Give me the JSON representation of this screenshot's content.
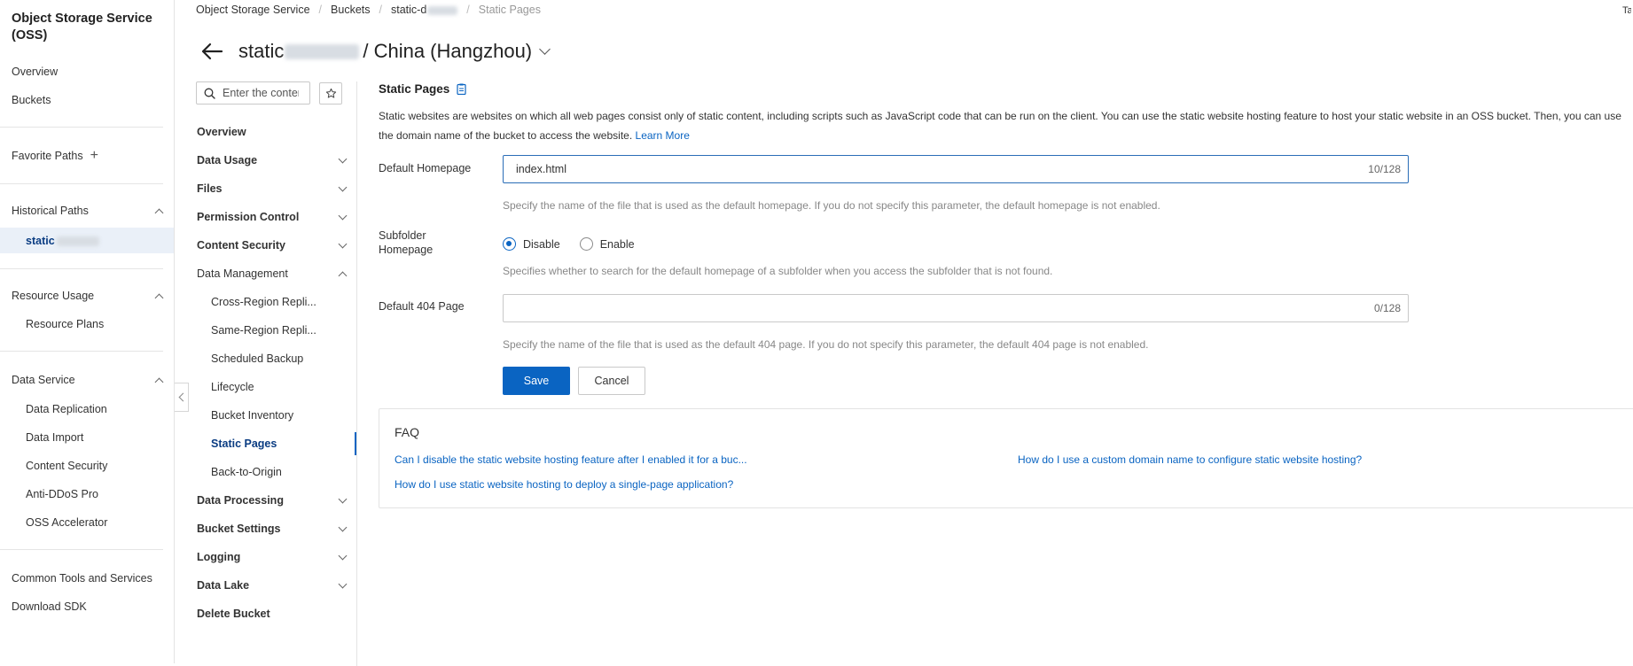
{
  "sidebar": {
    "title": "Object Storage Service (OSS)",
    "overview": "Overview",
    "buckets": "Buckets",
    "favorite_paths": "Favorite Paths",
    "historical_paths": "Historical Paths",
    "historical_item": "static",
    "resource_usage": "Resource Usage",
    "resource_plans": "Resource Plans",
    "data_service": "Data Service",
    "data_service_items": [
      "Data Replication",
      "Data Import",
      "Content Security",
      "Anti-DDoS Pro",
      "OSS Accelerator"
    ],
    "common_tools": "Common Tools and Services",
    "download_sdk": "Download SDK"
  },
  "breadcrumb": {
    "items": [
      "Object Storage Service",
      "Buckets",
      "static-d"
    ],
    "current": "Static Pages"
  },
  "topright": "Tas",
  "header": {
    "bucket_prefix": "static",
    "bucket_suffix": "/ China (Hangzhou)"
  },
  "bucket_nav": {
    "search_placeholder": "Enter the conter",
    "items": [
      {
        "label": "Overview"
      },
      {
        "label": "Data Usage"
      },
      {
        "label": "Files"
      },
      {
        "label": "Permission Control"
      },
      {
        "label": "Content Security"
      },
      {
        "label": "Data Management"
      }
    ],
    "data_management_children": [
      "Cross-Region Repli...",
      "Same-Region Repli...",
      "Scheduled Backup",
      "Lifecycle",
      "Bucket Inventory",
      "Static Pages",
      "Back-to-Origin"
    ],
    "after_items": [
      "Data Processing",
      "Bucket Settings",
      "Logging",
      "Data Lake",
      "Delete Bucket"
    ]
  },
  "main": {
    "title": "Static Pages",
    "description": "Static websites are websites on which all web pages consist only of static content, including scripts such as JavaScript code that can be run on the client. You can use the static website hosting feature to host your static website in an OSS bucket. Then, you can use the domain name of the bucket to access the website.",
    "learn_more": "Learn More",
    "default_homepage": {
      "label": "Default Homepage",
      "value": "index.html",
      "counter": "10/128",
      "hint": "Specify the name of the file that is used as the default homepage. If you do not specify this parameter, the default homepage is not enabled."
    },
    "subfolder_homepage": {
      "label": "Subfolder Homepage",
      "options": [
        "Disable",
        "Enable"
      ],
      "selected": "Disable",
      "hint": "Specifies whether to search for the default homepage of a subfolder when you access the subfolder that is not found."
    },
    "default_404": {
      "label": "Default 404 Page",
      "value": "",
      "counter": "0/128",
      "hint": "Specify the name of the file that is used as the default 404 page. If you do not specify this parameter, the default 404 page is not enabled."
    },
    "save_label": "Save",
    "cancel_label": "Cancel"
  },
  "faq": {
    "title": "FAQ",
    "links": [
      "Can I disable the static website hosting feature after I enabled it for a buc...",
      "How do I use a custom domain name to configure static website hosting?",
      "How do I use static website hosting to deploy a single-page application?"
    ]
  },
  "colors": {
    "primary": "#0a64c2",
    "active_text": "#0a3c82",
    "active_bg": "#eaf0f8"
  }
}
